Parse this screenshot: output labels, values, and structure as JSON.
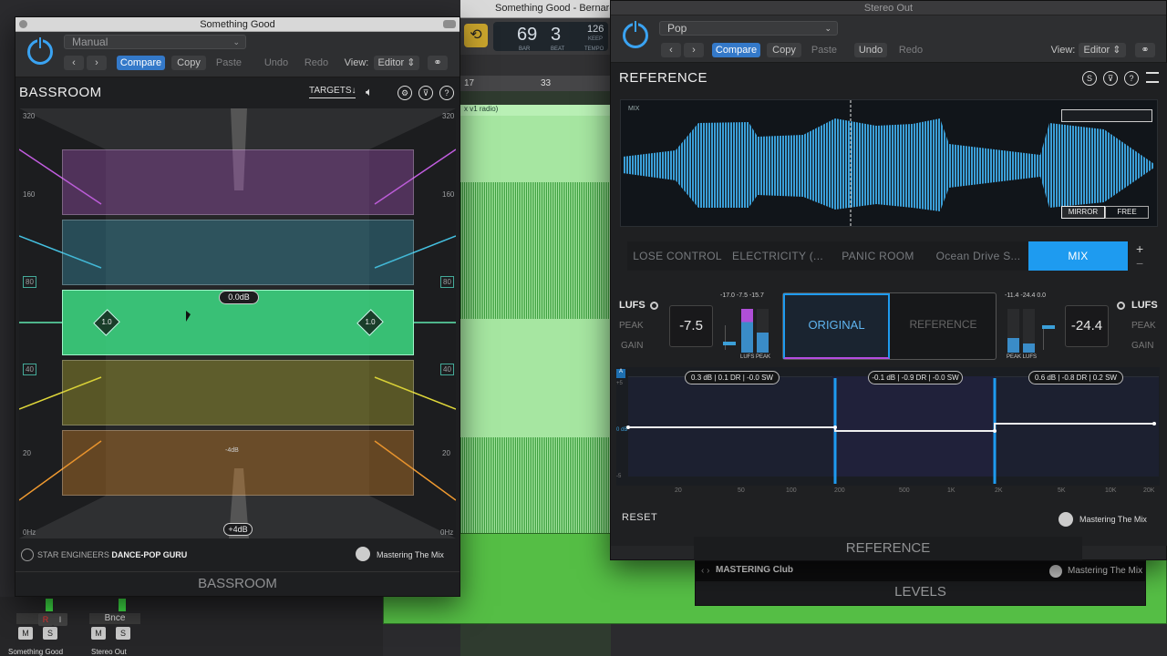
{
  "daw": {
    "title": "Something Good - Bernardo",
    "lcd_bar": "69",
    "lcd_beat": "3",
    "lcd_bar_label": "BAR",
    "lcd_beat_label": "BEAT",
    "lcd_tempo": "126",
    "lcd_keep": "KEEP",
    "lcd_tempo_label": "TEMPO",
    "ruler_marks": [
      "17",
      "33"
    ],
    "region_name": "x v1 radio)",
    "mixer": {
      "strip1_name": "Something Good",
      "strip2_name": "Stereo Out",
      "strip2_label": "Bnce",
      "mute": "M",
      "solo": "S",
      "rec": "R",
      "input": "I"
    }
  },
  "bassroom_window": {
    "title": "Something Good",
    "preset": "Manual",
    "compare": "Compare",
    "copy": "Copy",
    "paste": "Paste",
    "undo": "Undo",
    "redo": "Redo",
    "view_label": "View:",
    "view_value": "Editor",
    "plugin_name": "BASSROOM",
    "targets": "TARGETS",
    "freq_left": [
      "320",
      "160",
      "80",
      "40",
      "20",
      "0Hz"
    ],
    "freq_right": [
      "320",
      "160",
      "80",
      "40",
      "20",
      "0Hz"
    ],
    "band_gain": "0.0dB",
    "q_left": "1.0",
    "q_right": "1.0",
    "low_gain_label": "-4dB",
    "low_gain_pill": "+4dB",
    "footer_preset_brand": "STAR ENGINEERS",
    "footer_preset_name": "DANCE-POP GURU",
    "brand": "Mastering The Mix",
    "bottom_title": "BASSROOM",
    "band_colors": [
      "#b25cc9",
      "#3fa5bf",
      "#3ddc84",
      "#c8c235",
      "#d98a2b"
    ]
  },
  "reference_window": {
    "title": "Stereo Out",
    "preset": "Pop",
    "compare": "Compare",
    "copy": "Copy",
    "paste": "Paste",
    "undo": "Undo",
    "redo": "Redo",
    "view_label": "View:",
    "view_value": "Editor",
    "plugin_name": "REFERENCE",
    "wave_label": "MIX",
    "mirror": "MIRROR",
    "free": "FREE",
    "tabs": [
      "LOSE CONTROL",
      "ELECTRICITY (...",
      "PANIC ROOM",
      "Ocean Drive S...",
      "MIX"
    ],
    "active_tab": "MIX",
    "plus": "+",
    "minus": "−",
    "lufs_left": "LUFS",
    "lufs_right": "LUFS",
    "peak": "PEAK",
    "gain": "GAIN",
    "left_value": "-7.5",
    "right_value": "-24.4",
    "left_meter_vals": [
      "-17.0",
      "-7.5",
      "-15.7"
    ],
    "left_meter_lbls": [
      "LUFS",
      "PEAK"
    ],
    "right_meter_vals": [
      "-11.4",
      "-24.4",
      "0.0"
    ],
    "right_meter_lbls": [
      "PEAK",
      "LUFS"
    ],
    "original": "ORIGINAL",
    "reference": "REFERENCE",
    "chips": [
      "0.3 dB | 0.1 DR | -0.0 SW",
      "-0.1 dB | -0.9 DR | -0.0 SW",
      "0.6 dB | -0.8 DR | 0.2 SW"
    ],
    "eq_y": [
      "A",
      "+5",
      "0 dB",
      "-5"
    ],
    "freq_axis": [
      "20",
      "50",
      "100",
      "200",
      "500",
      "1K",
      "2K",
      "5K",
      "10K",
      "20K"
    ],
    "reset": "RESET",
    "brand": "Mastering The Mix",
    "bottom_title": "REFERENCE",
    "accent": "#1e9bf0"
  },
  "levels_window": {
    "brand_prefix": "MASTERING",
    "brand_suffix": "Club",
    "brand": "Mastering The Mix",
    "bottom_title": "LEVELS"
  }
}
